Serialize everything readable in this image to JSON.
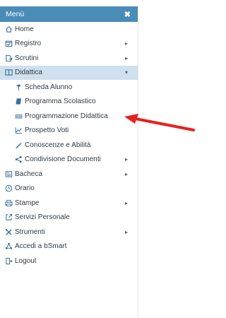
{
  "menu": {
    "title": "Menù",
    "close_glyph": "✖",
    "items": [
      {
        "label": "Home",
        "icon": "home-icon",
        "level": 0,
        "chevron": ""
      },
      {
        "label": "Registro",
        "icon": "calendar-check-icon",
        "level": 0,
        "chevron": "▸"
      },
      {
        "label": "Scrutini",
        "icon": "file-export-icon",
        "level": 0,
        "chevron": "▸"
      },
      {
        "label": "Didattica",
        "icon": "book-columns-icon",
        "level": 0,
        "chevron": "▾",
        "active": true
      },
      {
        "label": "Scheda Alunno",
        "icon": "student-icon",
        "level": 1,
        "chevron": ""
      },
      {
        "label": "Programma Scolastico",
        "icon": "book-icon",
        "level": 1,
        "chevron": ""
      },
      {
        "label": "Programmazione Didattica",
        "icon": "keyboard-icon",
        "level": 1,
        "chevron": ""
      },
      {
        "label": "Prospetto Voti",
        "icon": "line-chart-icon",
        "level": 1,
        "chevron": ""
      },
      {
        "label": "Conoscenze e Abilità",
        "icon": "magic-wand-icon",
        "level": 1,
        "chevron": ""
      },
      {
        "label": "Condivisione Documenti",
        "icon": "share-icon",
        "level": 1,
        "chevron": "▸"
      },
      {
        "label": "Bacheca",
        "icon": "newspaper-icon",
        "level": 0,
        "chevron": "▸"
      },
      {
        "label": "Orario",
        "icon": "clock-icon",
        "level": 0,
        "chevron": ""
      },
      {
        "label": "Stampe",
        "icon": "printer-icon",
        "level": 0,
        "chevron": "▸"
      },
      {
        "label": "Servizi Personale",
        "icon": "external-link-icon",
        "level": 0,
        "chevron": ""
      },
      {
        "label": "Strumenti",
        "icon": "tools-icon",
        "level": 0,
        "chevron": "▸"
      },
      {
        "label": "Accedi a bSmart",
        "icon": "network-icon",
        "level": 0,
        "chevron": ""
      },
      {
        "label": "Logout",
        "icon": "logout-icon",
        "level": 0,
        "chevron": ""
      }
    ]
  },
  "colors": {
    "header_bg": "#4a8cb8",
    "active_bg": "#cfe0ee",
    "text": "#2f3a44",
    "icon": "#3a6f9b",
    "arrow": "#e8201c"
  }
}
